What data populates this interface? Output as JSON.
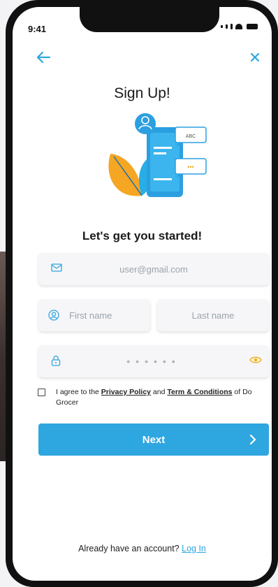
{
  "status": {
    "time": "9:41"
  },
  "nav": {
    "back_icon": "arrow-left-icon",
    "close_icon": "close-icon"
  },
  "title": "Sign Up!",
  "subtitle": "Let's get you started!",
  "illustration": {
    "bubble1": "ABC",
    "bubble2": "•••"
  },
  "form": {
    "email_placeholder": "user@gmail.com",
    "first_name_placeholder": "First name",
    "last_name_placeholder": "Last name",
    "password_masked": "••••••",
    "agree_prefix": "I agree to the ",
    "privacy_link": "Privacy Policy",
    "agree_mid": " and ",
    "terms_link": "Term & Conditions",
    "agree_suffix": " of Do Grocer",
    "next_label": "Next",
    "next_icon": "chevron-right-icon"
  },
  "footer": {
    "prompt": "Already have an account? ",
    "login_link": "Log In"
  },
  "colors": {
    "accent": "#2ea6e0",
    "eye": "#f2b01e",
    "leaf_orange": "#f5a623"
  }
}
